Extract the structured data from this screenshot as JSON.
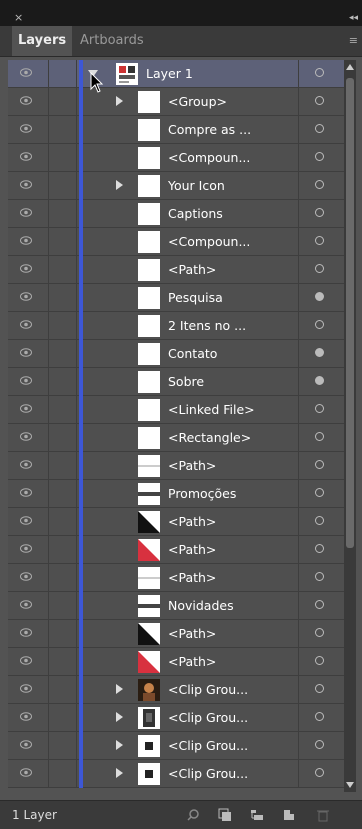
{
  "panel": {
    "close_glyph": "×",
    "collapse_glyph": "◂◂",
    "menu_glyph": "≡",
    "tabs": [
      {
        "label": "Layers",
        "active": true
      },
      {
        "label": "Artboards",
        "active": false
      }
    ]
  },
  "colors": {
    "layer_color": "#3d57d6",
    "selected_row": "#5d6178"
  },
  "layers": [
    {
      "name": "Layer 1",
      "depth": 0,
      "twisty": "open",
      "thumb": "layer",
      "target": "open",
      "selected": true
    },
    {
      "name": "<Group>",
      "depth": 1,
      "twisty": "closed",
      "thumb": "white",
      "target": "open"
    },
    {
      "name": "Compre as ...",
      "depth": 1,
      "twisty": "none",
      "thumb": "white",
      "target": "open"
    },
    {
      "name": "<Compoun...",
      "depth": 1,
      "twisty": "none",
      "thumb": "white",
      "target": "open"
    },
    {
      "name": "Your Icon",
      "depth": 1,
      "twisty": "closed",
      "thumb": "white",
      "target": "open"
    },
    {
      "name": "Captions",
      "depth": 1,
      "twisty": "none",
      "thumb": "white",
      "target": "open"
    },
    {
      "name": "<Compoun...",
      "depth": 1,
      "twisty": "none",
      "thumb": "white",
      "target": "open"
    },
    {
      "name": "<Path>",
      "depth": 1,
      "twisty": "none",
      "thumb": "white",
      "target": "open"
    },
    {
      "name": "Pesquisa",
      "depth": 1,
      "twisty": "none",
      "thumb": "white",
      "target": "filled"
    },
    {
      "name": "2 Itens no ...",
      "depth": 1,
      "twisty": "none",
      "thumb": "white",
      "target": "open"
    },
    {
      "name": "Contato",
      "depth": 1,
      "twisty": "none",
      "thumb": "white",
      "target": "filled"
    },
    {
      "name": "Sobre",
      "depth": 1,
      "twisty": "none",
      "thumb": "white",
      "target": "filled"
    },
    {
      "name": "<Linked File>",
      "depth": 1,
      "twisty": "none",
      "thumb": "white",
      "target": "open"
    },
    {
      "name": "<Rectangle>",
      "depth": 1,
      "twisty": "none",
      "thumb": "white",
      "target": "open"
    },
    {
      "name": "<Path>",
      "depth": 1,
      "twisty": "none",
      "thumb": "line",
      "target": "open"
    },
    {
      "name": "Promoções",
      "depth": 1,
      "twisty": "none",
      "thumb": "bar",
      "target": "open"
    },
    {
      "name": "<Path>",
      "depth": 1,
      "twisty": "none",
      "thumb": "black-tri",
      "target": "open"
    },
    {
      "name": "<Path>",
      "depth": 1,
      "twisty": "none",
      "thumb": "red-tri",
      "target": "open"
    },
    {
      "name": "<Path>",
      "depth": 1,
      "twisty": "none",
      "thumb": "line",
      "target": "open"
    },
    {
      "name": "Novidades",
      "depth": 1,
      "twisty": "none",
      "thumb": "bar",
      "target": "open"
    },
    {
      "name": "<Path>",
      "depth": 1,
      "twisty": "none",
      "thumb": "black-tri",
      "target": "open"
    },
    {
      "name": "<Path>",
      "depth": 1,
      "twisty": "none",
      "thumb": "red-tri",
      "target": "open"
    },
    {
      "name": "<Clip Grou...",
      "depth": 1,
      "twisty": "closed",
      "thumb": "photo",
      "target": "open"
    },
    {
      "name": "<Clip Grou...",
      "depth": 1,
      "twisty": "closed",
      "thumb": "dark",
      "target": "open"
    },
    {
      "name": "<Clip Grou...",
      "depth": 1,
      "twisty": "closed",
      "thumb": "icon-small",
      "target": "open"
    },
    {
      "name": "<Clip Grou...",
      "depth": 1,
      "twisty": "closed",
      "thumb": "icon-small",
      "target": "open"
    }
  ],
  "footer": {
    "label": "1 Layer",
    "icons": [
      "locate-object-icon",
      "make-clipping-mask-icon",
      "new-sublayer-icon",
      "new-layer-icon",
      "trash-icon"
    ]
  }
}
